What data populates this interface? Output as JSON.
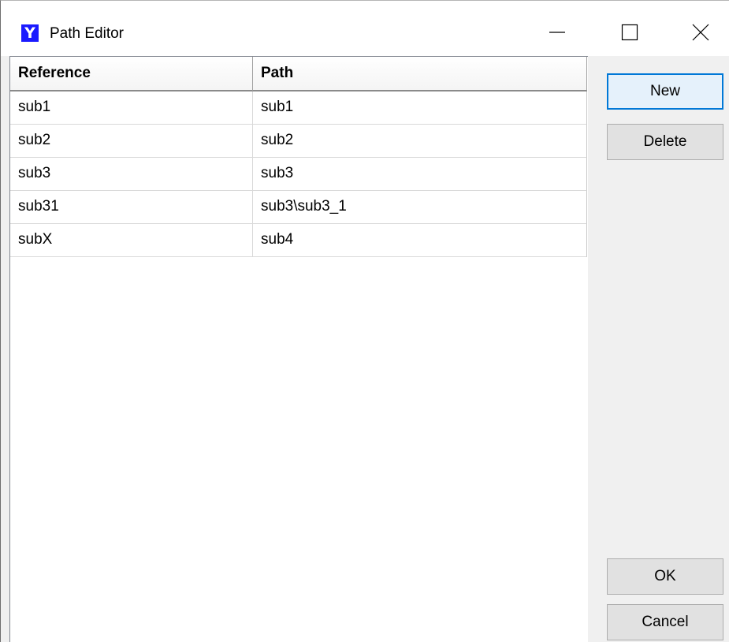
{
  "window": {
    "title": "Path Editor",
    "icon": "y-app-icon"
  },
  "titlebar_buttons": {
    "minimize_icon": "minimize-icon",
    "maximize_icon": "maximize-icon",
    "close_icon": "close-icon"
  },
  "table": {
    "columns": [
      "Reference",
      "Path"
    ],
    "rows": [
      [
        "sub1",
        "sub1"
      ],
      [
        "sub2",
        "sub2"
      ],
      [
        "sub3",
        "sub3"
      ],
      [
        "sub31",
        "sub3\\sub3_1"
      ],
      [
        "subX",
        "sub4"
      ]
    ]
  },
  "buttons": {
    "new_label": "New",
    "delete_label": "Delete",
    "ok_label": "OK",
    "cancel_label": "Cancel"
  },
  "colors": {
    "app_icon_bg": "#1a1aff",
    "default_button_border": "#0078d7"
  }
}
